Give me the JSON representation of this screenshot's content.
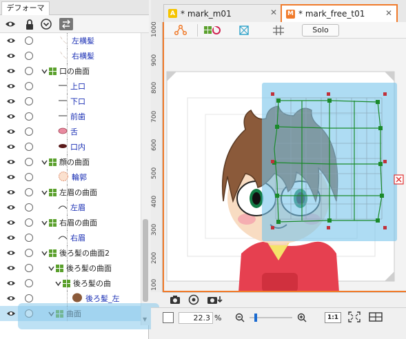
{
  "panel": {
    "tab_label": "デフォーマ",
    "toolbar_icons": [
      "eye-icon",
      "lock-icon",
      "circle-chevron-down-icon",
      "swap-icon"
    ]
  },
  "tree_rows": [
    {
      "label": "左横髪",
      "depth": 3,
      "kind": "hair-thumb",
      "blue": true
    },
    {
      "label": "右横髪",
      "depth": 3,
      "kind": "hair-thumb",
      "blue": true
    },
    {
      "label": "口の曲面",
      "depth": 2,
      "kind": "warp",
      "blue": false
    },
    {
      "label": "上口",
      "depth": 3,
      "kind": "line",
      "blue": true
    },
    {
      "label": "下口",
      "depth": 3,
      "kind": "line",
      "blue": true
    },
    {
      "label": "前歯",
      "depth": 3,
      "kind": "line",
      "blue": true
    },
    {
      "label": "舌",
      "depth": 3,
      "kind": "pink-oval",
      "blue": true
    },
    {
      "label": "口内",
      "depth": 3,
      "kind": "dark-oval",
      "blue": true
    },
    {
      "label": "顔の曲面",
      "depth": 2,
      "kind": "warp",
      "blue": false
    },
    {
      "label": "輪郭",
      "depth": 3,
      "kind": "face-thumb",
      "blue": true
    },
    {
      "label": "左眉の曲面",
      "depth": 2,
      "kind": "warp",
      "blue": false
    },
    {
      "label": "左眉",
      "depth": 3,
      "kind": "brow",
      "blue": true
    },
    {
      "label": "右眉の曲面",
      "depth": 2,
      "kind": "warp",
      "blue": false
    },
    {
      "label": "右眉",
      "depth": 3,
      "kind": "brow",
      "blue": true
    },
    {
      "label": "後ろ髪の曲面2",
      "depth": 2,
      "kind": "warp",
      "blue": false
    },
    {
      "label": "後ろ髪の曲面",
      "depth": 3,
      "kind": "warp",
      "blue": false
    },
    {
      "label": "後ろ髪の曲",
      "depth": 4,
      "kind": "warp",
      "blue": false
    },
    {
      "label": "後ろ髪_左",
      "depth": 5,
      "kind": "back-hair-thumb",
      "blue": true
    },
    {
      "label": "曲面",
      "depth": 3,
      "kind": "warp",
      "blue": false,
      "selected": true
    }
  ],
  "viewer": {
    "tabs": [
      {
        "icon": "A",
        "label": "* mark_m01",
        "active": false
      },
      {
        "icon": "M",
        "label": "* mark_free_t01",
        "active": true
      }
    ],
    "ruler_labels": [
      "1000",
      "900",
      "800",
      "700",
      "600",
      "500",
      "400",
      "300",
      "200",
      "100"
    ],
    "solo_label": "Solo",
    "zoom_value": "22.3",
    "zoom_unit": "%",
    "ratio_label": "1:1",
    "zoom_slider_fraction": 0.12
  },
  "colors": {
    "accent": "#f07a2a",
    "selection": "#87c8eb",
    "warp_green": "#5aa02c",
    "deformer_green": "#1a8a2a",
    "close_red": "#e03030"
  }
}
